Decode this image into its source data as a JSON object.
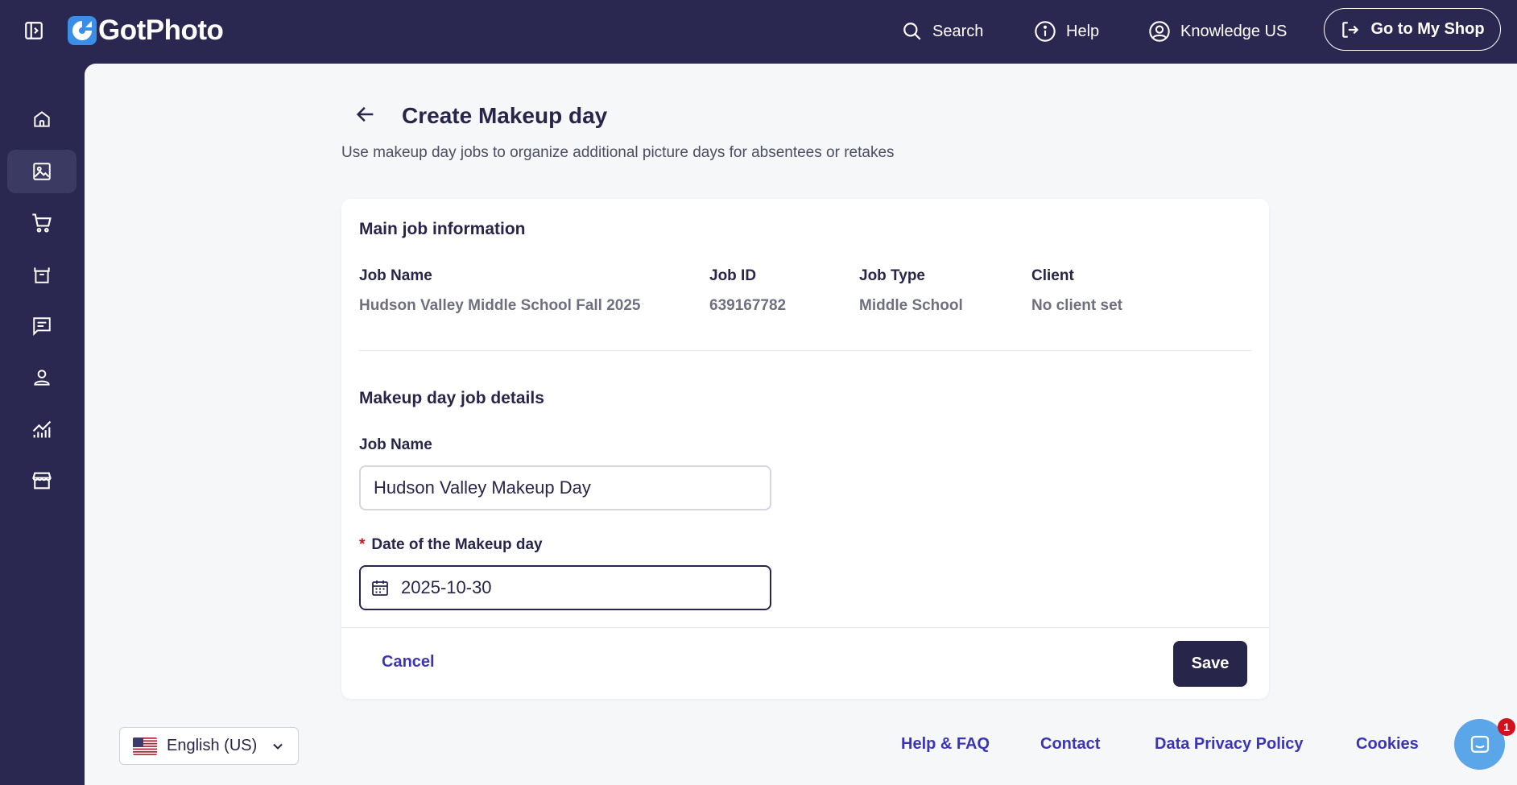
{
  "header": {
    "logo_text": "GotPhoto",
    "search_label": "Search",
    "help_label": "Help",
    "account_label": "Knowledge US",
    "shop_button_label": "Go to My Shop"
  },
  "sidebar": {
    "items": [
      {
        "icon": "home-icon"
      },
      {
        "icon": "image-icon",
        "active": true
      },
      {
        "icon": "cart-icon"
      },
      {
        "icon": "box-icon"
      },
      {
        "icon": "message-icon"
      },
      {
        "icon": "person-icon"
      },
      {
        "icon": "analytics-icon"
      },
      {
        "icon": "store-icon"
      }
    ]
  },
  "page": {
    "title": "Create Makeup day",
    "subtitle": "Use makeup day jobs to organize additional picture days for absentees or retakes"
  },
  "main_info": {
    "section_title": "Main job information",
    "fields": [
      {
        "label": "Job Name",
        "value": "Hudson Valley Middle School Fall 2025"
      },
      {
        "label": "Job ID",
        "value": "639167782"
      },
      {
        "label": "Job Type",
        "value": "Middle School"
      },
      {
        "label": "Client",
        "value": "No client set"
      }
    ]
  },
  "makeup": {
    "section_title": "Makeup day job details",
    "job_name_label": "Job Name",
    "job_name_value": "Hudson Valley Makeup Day",
    "date_required_marker": "*",
    "date_label": "Date of the Makeup day",
    "date_value": "2025-10-30"
  },
  "actions": {
    "cancel_label": "Cancel",
    "save_label": "Save"
  },
  "footer": {
    "language_label": "English (US)",
    "links": [
      "Help & FAQ",
      "Contact",
      "Data Privacy Policy",
      "Cookies"
    ],
    "chat_badge_count": "1"
  },
  "colors": {
    "nav_bg": "#2a2850",
    "primary": "#27264a",
    "link": "#3b35b5",
    "required": "#d0121f",
    "chat": "#5aa6e8"
  }
}
